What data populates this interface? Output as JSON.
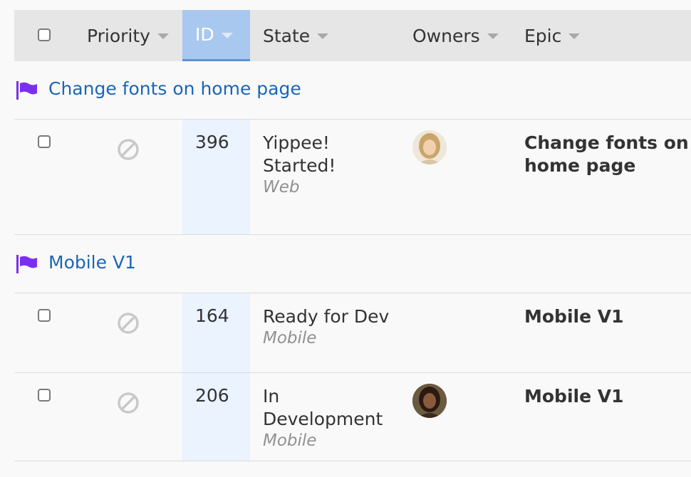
{
  "header": {
    "priority": "Priority",
    "id": "ID",
    "state": "State",
    "owners": "Owners",
    "epic": "Epic"
  },
  "groups": [
    {
      "title": "Change fonts on home page",
      "rows": [
        {
          "id": "396",
          "state_line1": "Yippee!",
          "state_line2": "Started!",
          "project": "Web",
          "epic_line1": "Change fonts on",
          "epic_line2": "home page",
          "owner": "avatar-woman-blonde"
        }
      ]
    },
    {
      "title": "Mobile V1",
      "rows": [
        {
          "id": "164",
          "state_line1": "Ready for Dev",
          "project": "Mobile",
          "epic_line1": "Mobile V1"
        },
        {
          "id": "206",
          "state_line1": "In",
          "state_line2": "Development",
          "project": "Mobile",
          "epic_line1": "Mobile V1",
          "owner": "avatar-woman-dark-hair"
        }
      ]
    }
  ],
  "colors": {
    "accent": "#1c66b5",
    "flag": "#7a2ff0",
    "id_header": "#a8c8ef",
    "id_column": "#eaf3fe"
  }
}
